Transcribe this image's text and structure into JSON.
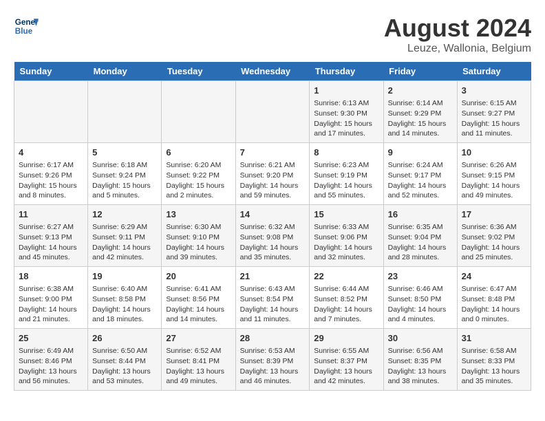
{
  "header": {
    "logo_line1": "General",
    "logo_line2": "Blue",
    "main_title": "August 2024",
    "subtitle": "Leuze, Wallonia, Belgium"
  },
  "days_of_week": [
    "Sunday",
    "Monday",
    "Tuesday",
    "Wednesday",
    "Thursday",
    "Friday",
    "Saturday"
  ],
  "weeks": [
    [
      {
        "day": "",
        "info": ""
      },
      {
        "day": "",
        "info": ""
      },
      {
        "day": "",
        "info": ""
      },
      {
        "day": "",
        "info": ""
      },
      {
        "day": "1",
        "info": "Sunrise: 6:13 AM\nSunset: 9:30 PM\nDaylight: 15 hours\nand 17 minutes."
      },
      {
        "day": "2",
        "info": "Sunrise: 6:14 AM\nSunset: 9:29 PM\nDaylight: 15 hours\nand 14 minutes."
      },
      {
        "day": "3",
        "info": "Sunrise: 6:15 AM\nSunset: 9:27 PM\nDaylight: 15 hours\nand 11 minutes."
      }
    ],
    [
      {
        "day": "4",
        "info": "Sunrise: 6:17 AM\nSunset: 9:26 PM\nDaylight: 15 hours\nand 8 minutes."
      },
      {
        "day": "5",
        "info": "Sunrise: 6:18 AM\nSunset: 9:24 PM\nDaylight: 15 hours\nand 5 minutes."
      },
      {
        "day": "6",
        "info": "Sunrise: 6:20 AM\nSunset: 9:22 PM\nDaylight: 15 hours\nand 2 minutes."
      },
      {
        "day": "7",
        "info": "Sunrise: 6:21 AM\nSunset: 9:20 PM\nDaylight: 14 hours\nand 59 minutes."
      },
      {
        "day": "8",
        "info": "Sunrise: 6:23 AM\nSunset: 9:19 PM\nDaylight: 14 hours\nand 55 minutes."
      },
      {
        "day": "9",
        "info": "Sunrise: 6:24 AM\nSunset: 9:17 PM\nDaylight: 14 hours\nand 52 minutes."
      },
      {
        "day": "10",
        "info": "Sunrise: 6:26 AM\nSunset: 9:15 PM\nDaylight: 14 hours\nand 49 minutes."
      }
    ],
    [
      {
        "day": "11",
        "info": "Sunrise: 6:27 AM\nSunset: 9:13 PM\nDaylight: 14 hours\nand 45 minutes."
      },
      {
        "day": "12",
        "info": "Sunrise: 6:29 AM\nSunset: 9:11 PM\nDaylight: 14 hours\nand 42 minutes."
      },
      {
        "day": "13",
        "info": "Sunrise: 6:30 AM\nSunset: 9:10 PM\nDaylight: 14 hours\nand 39 minutes."
      },
      {
        "day": "14",
        "info": "Sunrise: 6:32 AM\nSunset: 9:08 PM\nDaylight: 14 hours\nand 35 minutes."
      },
      {
        "day": "15",
        "info": "Sunrise: 6:33 AM\nSunset: 9:06 PM\nDaylight: 14 hours\nand 32 minutes."
      },
      {
        "day": "16",
        "info": "Sunrise: 6:35 AM\nSunset: 9:04 PM\nDaylight: 14 hours\nand 28 minutes."
      },
      {
        "day": "17",
        "info": "Sunrise: 6:36 AM\nSunset: 9:02 PM\nDaylight: 14 hours\nand 25 minutes."
      }
    ],
    [
      {
        "day": "18",
        "info": "Sunrise: 6:38 AM\nSunset: 9:00 PM\nDaylight: 14 hours\nand 21 minutes."
      },
      {
        "day": "19",
        "info": "Sunrise: 6:40 AM\nSunset: 8:58 PM\nDaylight: 14 hours\nand 18 minutes."
      },
      {
        "day": "20",
        "info": "Sunrise: 6:41 AM\nSunset: 8:56 PM\nDaylight: 14 hours\nand 14 minutes."
      },
      {
        "day": "21",
        "info": "Sunrise: 6:43 AM\nSunset: 8:54 PM\nDaylight: 14 hours\nand 11 minutes."
      },
      {
        "day": "22",
        "info": "Sunrise: 6:44 AM\nSunset: 8:52 PM\nDaylight: 14 hours\nand 7 minutes."
      },
      {
        "day": "23",
        "info": "Sunrise: 6:46 AM\nSunset: 8:50 PM\nDaylight: 14 hours\nand 4 minutes."
      },
      {
        "day": "24",
        "info": "Sunrise: 6:47 AM\nSunset: 8:48 PM\nDaylight: 14 hours\nand 0 minutes."
      }
    ],
    [
      {
        "day": "25",
        "info": "Sunrise: 6:49 AM\nSunset: 8:46 PM\nDaylight: 13 hours\nand 56 minutes."
      },
      {
        "day": "26",
        "info": "Sunrise: 6:50 AM\nSunset: 8:44 PM\nDaylight: 13 hours\nand 53 minutes."
      },
      {
        "day": "27",
        "info": "Sunrise: 6:52 AM\nSunset: 8:41 PM\nDaylight: 13 hours\nand 49 minutes."
      },
      {
        "day": "28",
        "info": "Sunrise: 6:53 AM\nSunset: 8:39 PM\nDaylight: 13 hours\nand 46 minutes."
      },
      {
        "day": "29",
        "info": "Sunrise: 6:55 AM\nSunset: 8:37 PM\nDaylight: 13 hours\nand 42 minutes."
      },
      {
        "day": "30",
        "info": "Sunrise: 6:56 AM\nSunset: 8:35 PM\nDaylight: 13 hours\nand 38 minutes."
      },
      {
        "day": "31",
        "info": "Sunrise: 6:58 AM\nSunset: 8:33 PM\nDaylight: 13 hours\nand 35 minutes."
      }
    ]
  ]
}
